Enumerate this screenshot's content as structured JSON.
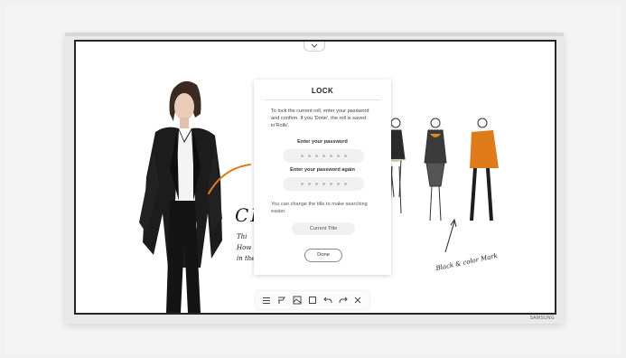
{
  "dialog": {
    "title": "LOCK",
    "description": "To lock the current roll, enter your password and confirm. If you 'Done', the roll is saved in'Rolls'.",
    "password_label": "Enter your password",
    "password_again_label": "Enter your password again",
    "password_placeholder_dots": 7,
    "hint": "You can change the title to make searching easier.",
    "title_field_value": "Current Title",
    "done_label": "Done"
  },
  "canvas": {
    "handwriting_big": "CL",
    "handwriting_lines": [
      "Thi",
      "How",
      "in the"
    ],
    "sketch_caption": "Black & color Mark"
  },
  "brand": "SAMSUNG",
  "toolbar": {
    "icons": [
      "menu-icon",
      "pen-icon",
      "image-icon",
      "select-icon",
      "undo-icon",
      "redo-icon",
      "close-icon"
    ]
  },
  "colors": {
    "accent_orange": "#e07b1c",
    "screen_frame": "#262626",
    "dialog_bg": "#ffffff"
  }
}
